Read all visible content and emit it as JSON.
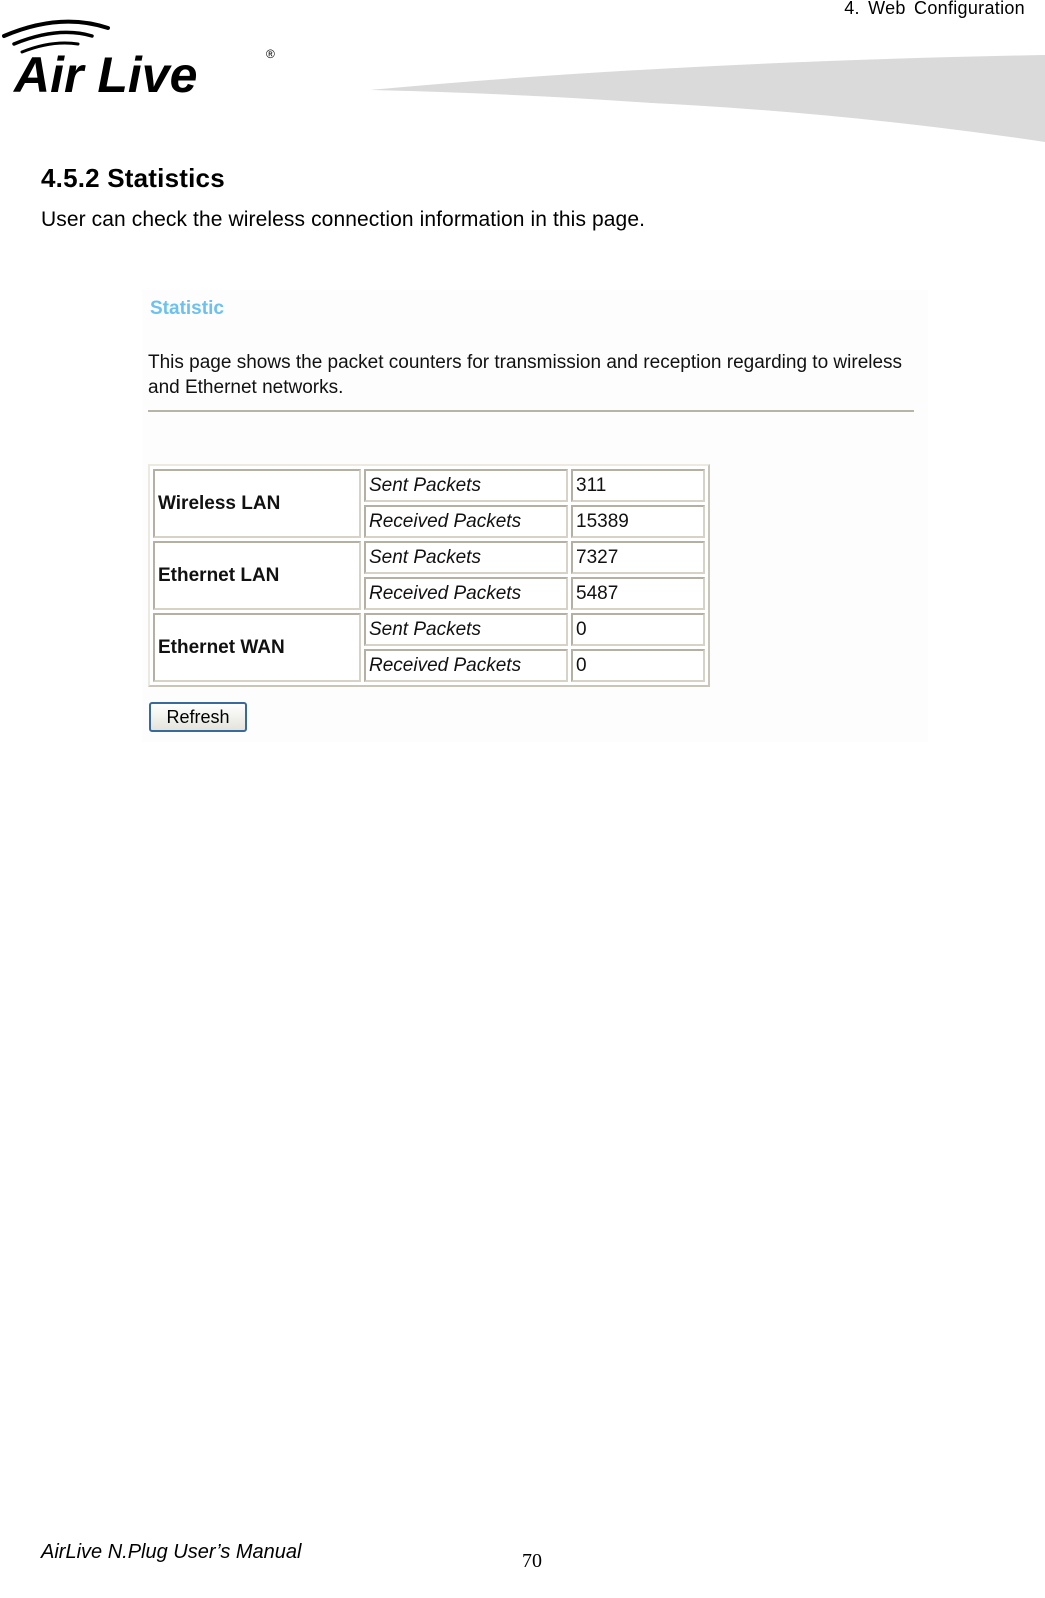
{
  "header": {
    "chapter": "4.  Web  Configuration",
    "logo_text": "Air Live",
    "logo_mark": "®"
  },
  "section": {
    "title": "4.5.2 Statistics",
    "intro": "User can check the wireless connection information in this page."
  },
  "screenshot": {
    "title": "Statistic",
    "description": "This page shows the packet counters for transmission and reception regarding to wireless and Ethernet networks.",
    "networks": [
      {
        "name": "Wireless LAN",
        "rows": [
          {
            "label": "Sent Packets",
            "value": "311"
          },
          {
            "label": "Received Packets",
            "value": "15389"
          }
        ]
      },
      {
        "name": "Ethernet LAN",
        "rows": [
          {
            "label": "Sent Packets",
            "value": "7327"
          },
          {
            "label": "Received Packets",
            "value": "5487"
          }
        ]
      },
      {
        "name": "Ethernet WAN",
        "rows": [
          {
            "label": "Sent Packets",
            "value": "0"
          },
          {
            "label": "Received Packets",
            "value": "0"
          }
        ]
      }
    ],
    "refresh_label": "Refresh",
    "title_color": "#6cc1ef"
  },
  "footer": {
    "manual": "AirLive N.Plug User’s Manual",
    "page": "70"
  }
}
